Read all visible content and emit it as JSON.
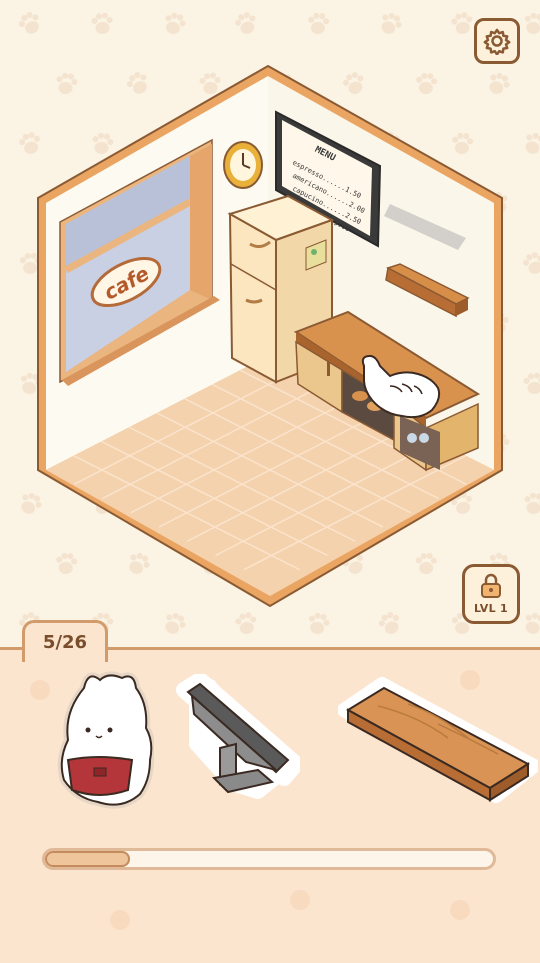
{
  "colors": {
    "background": "#fbf3e3",
    "wall": "#fdfaf2",
    "frame": "#eba563",
    "floor": "#f5d2ae",
    "tray": "#fbe5cf",
    "outline": "#8a5a33"
  },
  "header": {
    "settings_icon": "gear-icon"
  },
  "room": {
    "window_sign": "cafe",
    "menu_board": {
      "title": "MENU",
      "items": [
        {
          "name": "espresso",
          "price": "1.50"
        },
        {
          "name": "americano",
          "price": "2.00"
        },
        {
          "name": "capucino",
          "price": "2.50"
        },
        {
          "name": "Latte",
          "price": "3.00"
        }
      ]
    }
  },
  "level": {
    "label": "LVL 1",
    "icon": "lock-icon"
  },
  "tray": {
    "counter": "5/26",
    "items": [
      {
        "name": "cat-barista"
      },
      {
        "name": "tablet-stand"
      },
      {
        "name": "wooden-shelf"
      }
    ],
    "progress": 0.19
  }
}
